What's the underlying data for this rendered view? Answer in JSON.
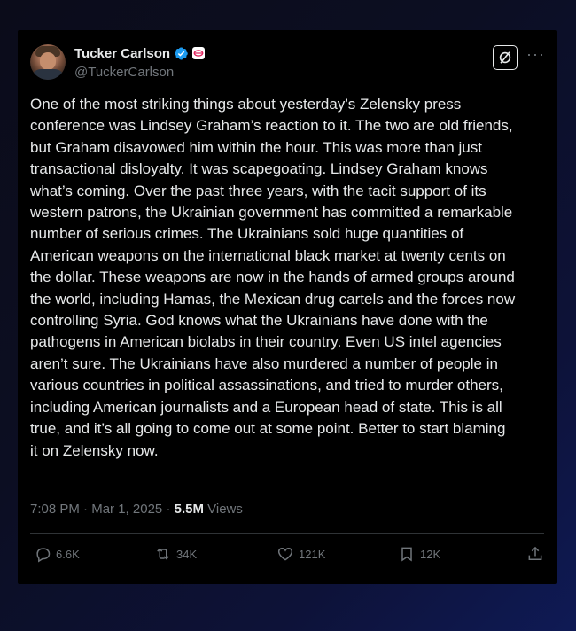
{
  "author": {
    "display_name": "Tucker Carlson",
    "handle": "@TuckerCarlson"
  },
  "tweet": {
    "text": "One of the most striking things about yesterday’s Zelensky press\nconference was Lindsey Graham’s reaction to it. The two are old friends,\nbut Graham disavowed him within the hour. This was more than just\ntransactional disloyalty. It was scapegoating. Lindsey Graham knows\nwhat’s coming. Over the past three years, with the tacit support of its\nwestern patrons, the Ukrainian government has committed a remarkable\nnumber of serious crimes. The Ukrainians sold huge quantities of\nAmerican weapons on the international black market at twenty cents on\nthe dollar. These weapons are now in the hands of armed groups around\nthe world, including Hamas, the Mexican drug cartels and the forces now\ncontrolling Syria. God knows what the Ukrainians have done with the\npathogens in American biolabs in their country. Even US intel agencies\naren’t sure. The Ukrainians have also murdered a number of people in\nvarious countries in political assassinations, and tried to murder others,\nincluding American journalists and a European head of state. This is all\ntrue, and it’s all going to come out at some point. Better to start blaming\nit on Zelensky now.",
    "time": "7:08 PM",
    "separator": "·",
    "date": "Mar 1, 2025",
    "views_count": "5.5M",
    "views_label": "Views"
  },
  "actions": {
    "replies": "6.6K",
    "reposts": "34K",
    "likes": "121K",
    "bookmarks": "12K"
  },
  "icons": {
    "verified": "verified-badge-icon",
    "affiliate": "affiliate-badge-icon",
    "grok": "grok-icon",
    "more": "more-icon",
    "reply": "reply-icon",
    "repost": "repost-icon",
    "like": "like-icon",
    "bookmark": "bookmark-icon",
    "share": "share-icon"
  },
  "colors": {
    "background": "#000000",
    "text": "#e7e9ea",
    "secondary": "#71767b",
    "verified": "#1d9bf0",
    "affiliate": "#e0245e"
  }
}
